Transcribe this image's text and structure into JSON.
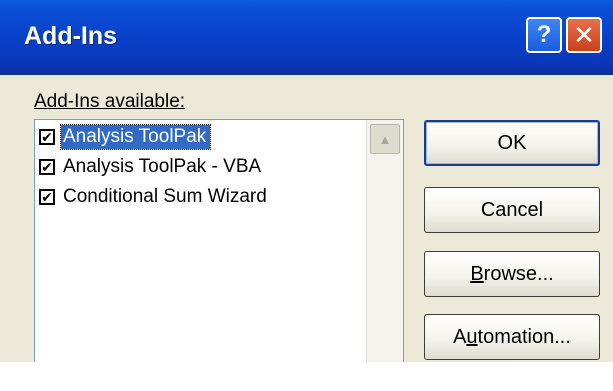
{
  "window": {
    "title": "Add-Ins"
  },
  "titlebar": {
    "help_glyph": "?",
    "close_glyph": "✕"
  },
  "list": {
    "label": "Add-Ins available:",
    "items": [
      {
        "label": "Analysis ToolPak",
        "checked": true,
        "selected": true
      },
      {
        "label": "Analysis ToolPak - VBA",
        "checked": true,
        "selected": false
      },
      {
        "label": "Conditional Sum Wizard",
        "checked": true,
        "selected": false
      }
    ],
    "scroll_up_glyph": "▲"
  },
  "buttons": {
    "ok": "OK",
    "cancel": "Cancel",
    "browse_pre": "",
    "browse_u": "B",
    "browse_post": "rowse...",
    "automation_pre": "A",
    "automation_u": "u",
    "automation_post": "tomation..."
  },
  "icons": {
    "help": "help-icon",
    "close": "close-icon",
    "check": "checkmark-icon",
    "scroll_up": "arrow-up-icon"
  },
  "colors": {
    "titlebar": "#0a4fd6",
    "selection": "#316ac5",
    "dialog_bg": "#ece9d8",
    "close": "#c9401c"
  }
}
